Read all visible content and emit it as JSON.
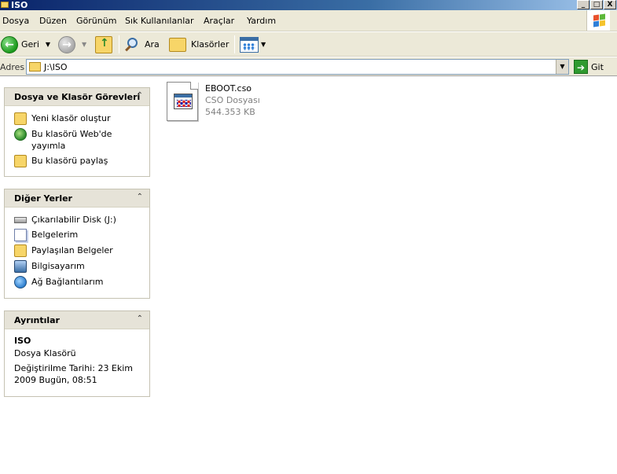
{
  "window": {
    "title": "ISO",
    "minimize": "_",
    "maximize": "□",
    "close": "X"
  },
  "menu": [
    "Dosya",
    "Düzen",
    "Görünüm",
    "Sık Kullanılanlar",
    "Araçlar",
    "Yardım"
  ],
  "toolbar": {
    "back_label": "Geri",
    "search_label": "Ara",
    "folders_label": "Klasörler"
  },
  "address": {
    "label": "Adres",
    "value": "J:\\ISO",
    "go_label": "Git"
  },
  "panels": {
    "tasks": {
      "title": "Dosya ve Klasör Görevleri",
      "items": [
        "Yeni klasör oluştur",
        "Bu klasörü Web'de yayımla",
        "Bu klasörü paylaş"
      ]
    },
    "places": {
      "title": "Diğer Yerler",
      "items": [
        "Çıkarılabilir Disk (J:)",
        "Belgelerim",
        "Paylaşılan Belgeler",
        "Bilgisayarım",
        "Ağ Bağlantılarım"
      ]
    },
    "details": {
      "title": "Ayrıntılar",
      "name": "ISO",
      "type": "Dosya Klasörü",
      "modified": "Değiştirilme Tarihi: 23 Ekim 2009 Bugün, 08:51"
    }
  },
  "files": [
    {
      "name": "EBOOT.cso",
      "type": "CSO Dosyası",
      "size": "544.353 KB"
    }
  ]
}
